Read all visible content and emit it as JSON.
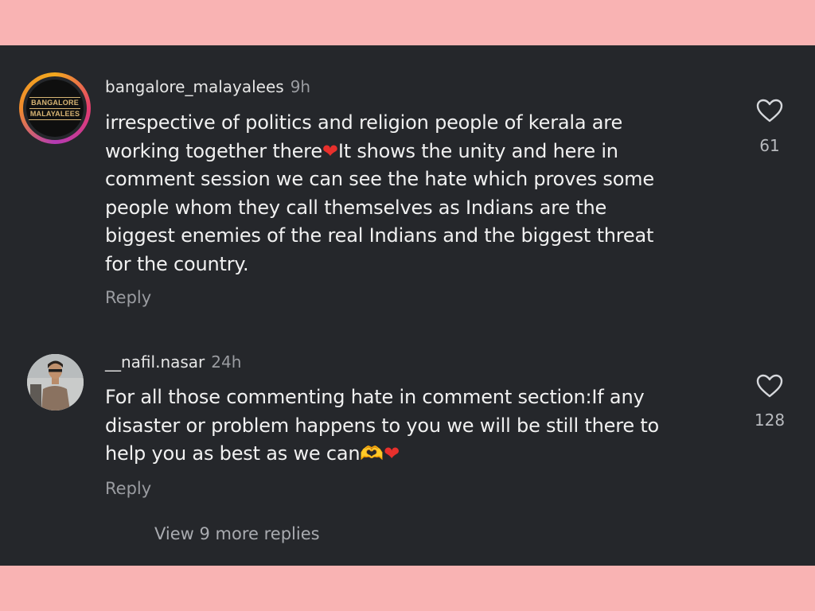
{
  "comments": [
    {
      "username": "bangalore_malayalees",
      "time": "9h",
      "avatar_text": [
        "BANGALORE",
        "MALAYALEES"
      ],
      "lines": [
        "irrespective of politics and religion people of kerala are",
        "working together there",
        "It shows the unity and here in",
        "comment session we can see the hate which proves some",
        "people whom they call themselves as Indians are the",
        "biggest enemies of the real Indians and the biggest threat",
        "for the country."
      ],
      "reply_label": "Reply",
      "likes": "61"
    },
    {
      "username": "__nafil.nasar",
      "time": "24h",
      "lines": [
        "For all those commenting hate in comment section:If any",
        "disaster or problem happens to you we will be  still there to",
        "help you as best as we can"
      ],
      "reply_label": "Reply",
      "likes": "128"
    }
  ],
  "view_more": "View 9 more replies",
  "emojis": {
    "red_heart": "❤",
    "heart_hands": "🫶"
  },
  "icons": {
    "like": "heart-outline-icon"
  },
  "colors": {
    "panel": "#25272b",
    "frame": "#f9b3b3",
    "heart": "#e8302c"
  }
}
